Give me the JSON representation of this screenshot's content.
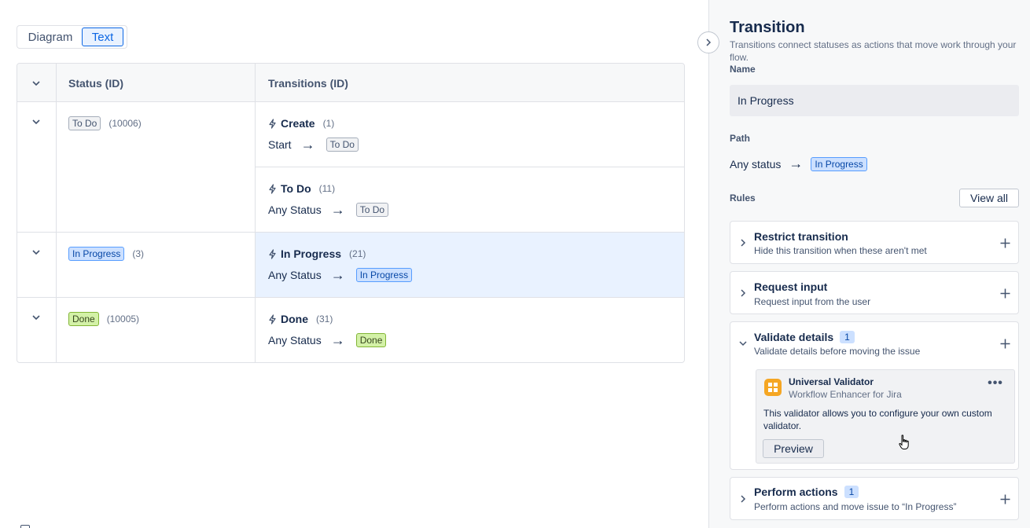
{
  "view_toggle": {
    "diagram": "Diagram",
    "text": "Text",
    "selected": "Text"
  },
  "table": {
    "headers": {
      "status": "Status (ID)",
      "transitions": "Transitions (ID)"
    },
    "statuses": [
      {
        "name": "To Do",
        "id": "(10006)",
        "color": "grey"
      },
      {
        "name": "In Progress",
        "id": "(3)",
        "color": "blue"
      },
      {
        "name": "Done",
        "id": "(10005)",
        "color": "green"
      }
    ],
    "transitions": [
      {
        "name": "Create",
        "id": "(1)",
        "from": "Start",
        "to": "To Do",
        "to_color": "grey"
      },
      {
        "name": "To Do",
        "id": "(11)",
        "from": "Any Status",
        "to": "To Do",
        "to_color": "grey"
      },
      {
        "name": "In Progress",
        "id": "(21)",
        "from": "Any Status",
        "to": "In Progress",
        "to_color": "blue",
        "selected": true
      },
      {
        "name": "Done",
        "id": "(31)",
        "from": "Any Status",
        "to": "Done",
        "to_color": "green"
      }
    ]
  },
  "panel": {
    "title": "Transition",
    "subtitle": "Transitions connect statuses as actions that move work through your flow.",
    "name_label": "Name",
    "name_value": "In Progress",
    "path_label": "Path",
    "path_from": "Any status",
    "path_to": "In Progress",
    "rules_label": "Rules",
    "view_all": "View all",
    "rules": [
      {
        "title": "Restrict transition",
        "desc": "Hide this transition when these aren't met",
        "expanded": false
      },
      {
        "title": "Request input",
        "desc": "Request input from the user",
        "expanded": false
      },
      {
        "title": "Validate details",
        "count": "1",
        "desc": "Validate details before moving the issue",
        "expanded": true
      },
      {
        "title": "Perform actions",
        "count": "1",
        "desc": "Perform actions and move issue to “In Progress”",
        "expanded": false
      }
    ],
    "validator": {
      "name": "Universal Validator",
      "vendor": "Workflow Enhancer for Jira",
      "description": "This validator allows you to configure your own custom validator.",
      "preview": "Preview",
      "icon": "app-grid-icon"
    }
  },
  "colors": {
    "accent": "#0c66e4",
    "selected_row": "#e9f2ff",
    "panel_bg": "#f7f8f9",
    "lozenge_blue": "#cce0ff",
    "lozenge_green": "#d3f1a7",
    "validator_icon": "#f5a623"
  }
}
